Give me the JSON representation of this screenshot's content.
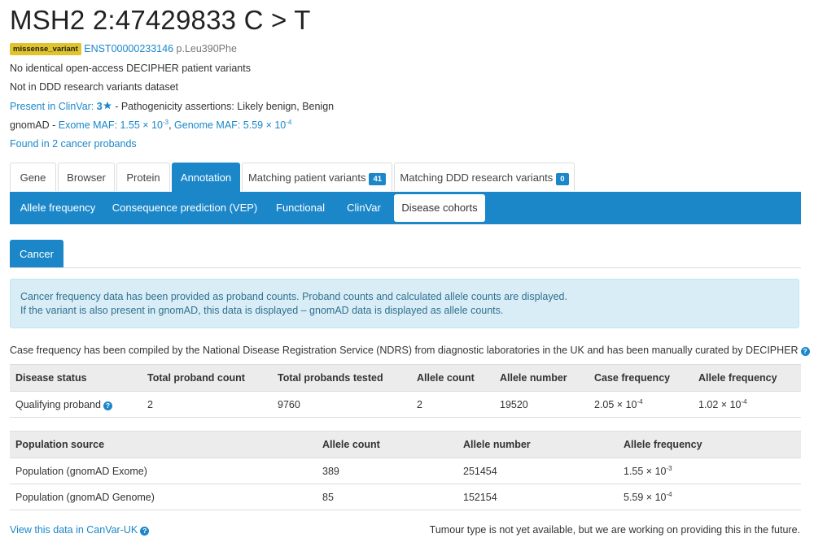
{
  "title": "MSH2 2:47429833 C > T",
  "variant": {
    "consequence": "missense_variant",
    "transcript": "ENST00000233146",
    "protein_change": "p.Leu390Phe"
  },
  "lines": {
    "no_identical": "No identical open-access DECIPHER patient variants",
    "not_in_ddd": "Not in DDD research variants dataset",
    "clinvar_link": "Present in ClinVar:",
    "clinvar_stars": "3",
    "clinvar_rest": " - Pathogenicity assertions: Likely benign, Benign",
    "gnomad_label": "gnomAD - ",
    "gnomad_exome_label": "Exome MAF: 1.55 × 10",
    "gnomad_exome_exp": "-3",
    "gnomad_sep": ", ",
    "gnomad_genome_label": "Genome MAF: 5.59 × 10",
    "gnomad_genome_exp": "-4",
    "cancer_probands": "Found in 2 cancer probands"
  },
  "tabs": [
    {
      "label": "Gene"
    },
    {
      "label": "Browser"
    },
    {
      "label": "Protein"
    },
    {
      "label": "Annotation"
    },
    {
      "label": "Matching patient variants",
      "count": "41"
    },
    {
      "label": "Matching DDD research variants",
      "count": "0"
    }
  ],
  "subtabs": [
    {
      "label": "Allele frequency"
    },
    {
      "label": "Consequence prediction (VEP)"
    },
    {
      "label": "Functional"
    },
    {
      "label": "ClinVar"
    },
    {
      "label": "Disease cohorts"
    }
  ],
  "cancer_tab": "Cancer",
  "info": {
    "line1": "Cancer frequency data has been provided as proband counts. Proband counts and calculated allele counts are displayed.",
    "line2": "If the variant is also present in gnomAD, this data is displayed – gnomAD data is displayed as allele counts."
  },
  "case_note": "Case frequency has been compiled by the National Disease Registration Service (NDRS) from diagnostic laboratories in the UK and has been manually curated by DECIPHER",
  "help_glyph": "?",
  "disease_table": {
    "headers": [
      "Disease status",
      "Total proband count",
      "Total probands tested",
      "Allele count",
      "Allele number",
      "Case frequency",
      "Allele frequency"
    ],
    "row": {
      "status": "Qualifying proband",
      "proband_count": "2",
      "tested": "9760",
      "allele_count": "2",
      "allele_number": "19520",
      "case_freq_base": "2.05 × 10",
      "case_freq_exp": "-4",
      "allele_freq_base": "1.02 × 10",
      "allele_freq_exp": "-4"
    }
  },
  "population_table": {
    "headers": [
      "Population source",
      "Allele count",
      "Allele number",
      "Allele frequency"
    ],
    "rows": [
      {
        "source": "Population (gnomAD Exome)",
        "count": "389",
        "number": "251454",
        "freq_base": "1.55 × 10",
        "freq_exp": "-3"
      },
      {
        "source": "Population (gnomAD Genome)",
        "count": "85",
        "number": "152154",
        "freq_base": "5.59 × 10",
        "freq_exp": "-4"
      }
    ]
  },
  "footer": {
    "canvar_link": "View this data in CanVar-UK",
    "tumour_note": "Tumour type is not yet available, but we are working on providing this in the future."
  },
  "colors": {
    "primary": "#1b87c9",
    "variant_badge": "#e0c42b",
    "info_bg": "#d9edf7",
    "info_text": "#31708f",
    "table_header_bg": "#ececec"
  }
}
